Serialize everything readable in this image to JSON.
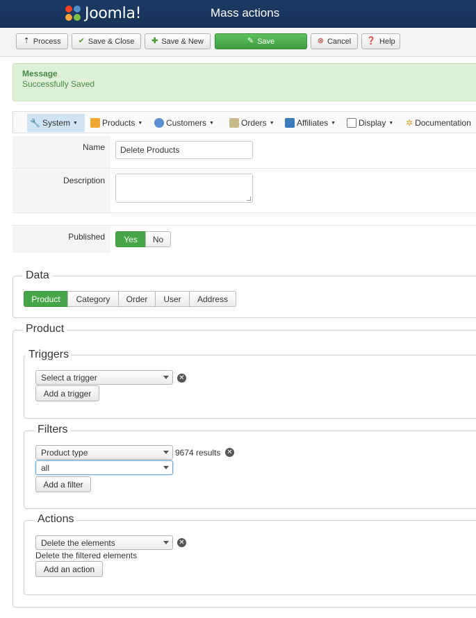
{
  "header": {
    "logo_text": "Joomla!",
    "title": "Mass actions"
  },
  "toolbar": {
    "process": "Process",
    "save_close": "Save & Close",
    "save_new": "Save & New",
    "save": "Save",
    "cancel": "Cancel",
    "help": "Help"
  },
  "message": {
    "heading": "Message",
    "text": "Successfully Saved"
  },
  "menu": {
    "items": [
      {
        "label": "System",
        "active": true
      },
      {
        "label": "Products"
      },
      {
        "label": "Customers"
      },
      {
        "label": "Orders"
      },
      {
        "label": "Affiliates"
      },
      {
        "label": "Display"
      },
      {
        "label": "Documentation"
      }
    ]
  },
  "form": {
    "name_label": "Name",
    "name_value": "Delete Products",
    "description_label": "Description",
    "description_value": "",
    "published_label": "Published",
    "published_yes": "Yes",
    "published_no": "No",
    "published_value": "Yes"
  },
  "data_section": {
    "legend": "Data",
    "tabs": [
      "Product",
      "Category",
      "Order",
      "User",
      "Address"
    ],
    "selected": "Product"
  },
  "product_section": {
    "legend": "Product",
    "triggers": {
      "legend": "Triggers",
      "select_value": "Select a trigger",
      "add_button": "Add a trigger"
    },
    "filters": {
      "legend": "Filters",
      "select_value": "Product type",
      "results": "9674 results",
      "sub_select_value": "all",
      "add_button": "Add a filter"
    },
    "actions": {
      "legend": "Actions",
      "select_value": "Delete the elements",
      "description": "Delete the filtered elements",
      "add_button": "Add an action"
    }
  }
}
